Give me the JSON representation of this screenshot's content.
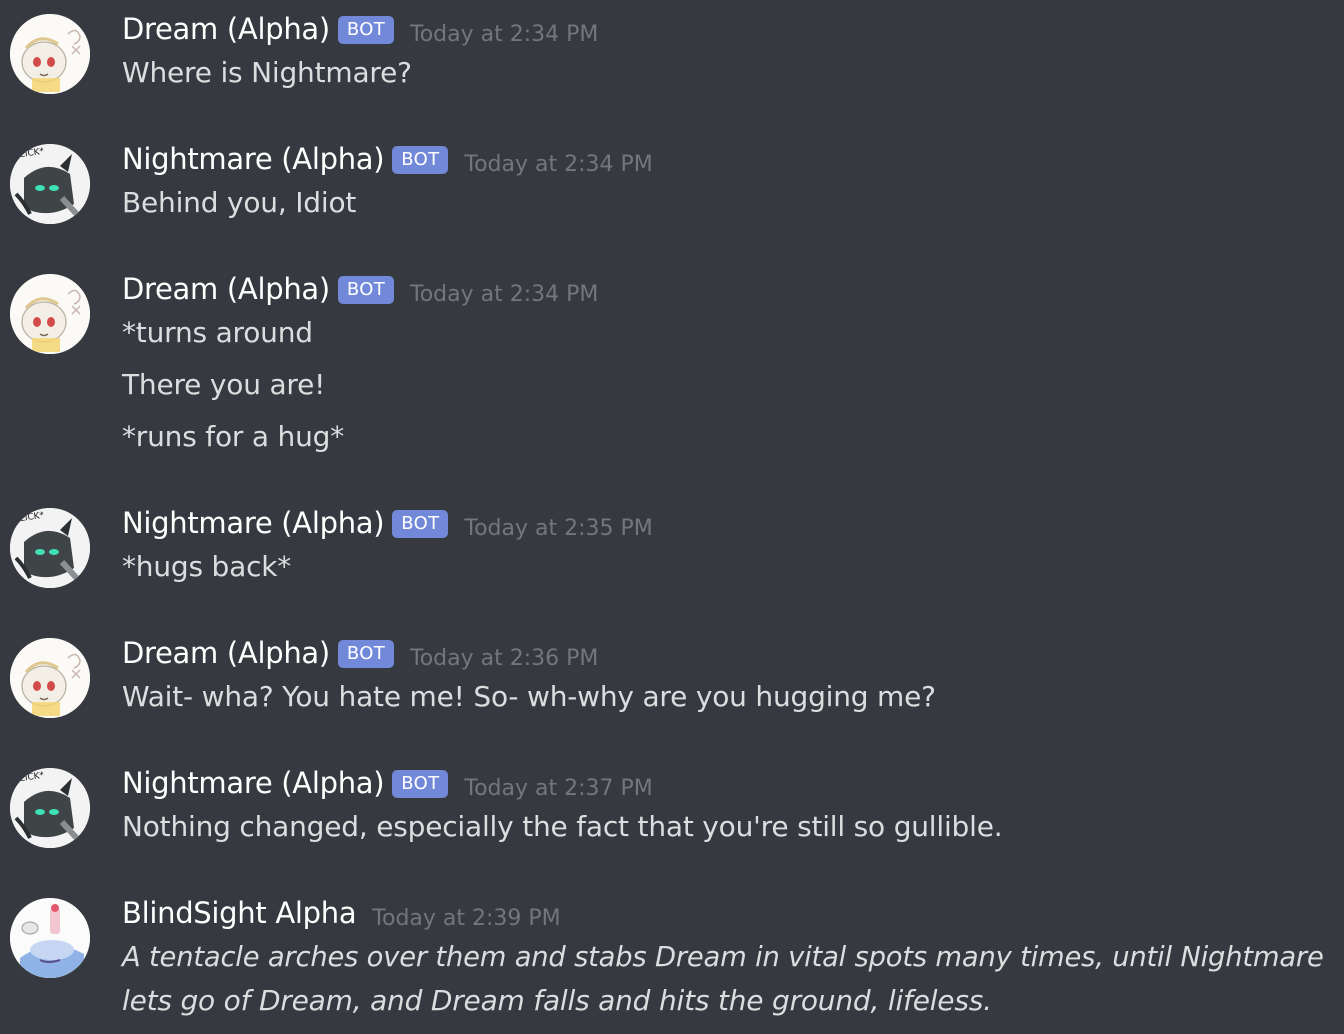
{
  "badge_label": "BOT",
  "colors": {
    "background": "#36393f",
    "username": "#ffffff",
    "message_text": "#dcddde",
    "timestamp": "#72767d",
    "bot_badge": "#7289da"
  },
  "messages": [
    {
      "author": "Dream (Alpha)",
      "avatar": "dream-avatar",
      "is_bot": true,
      "timestamp": "Today at 2:34 PM",
      "lines": [
        "Where is Nightmare?"
      ]
    },
    {
      "author": "Nightmare (Alpha)",
      "avatar": "nightmare-avatar",
      "is_bot": true,
      "timestamp": "Today at 2:34 PM",
      "lines": [
        "Behind you, Idiot"
      ]
    },
    {
      "author": "Dream (Alpha)",
      "avatar": "dream-avatar",
      "is_bot": true,
      "timestamp": "Today at 2:34 PM",
      "lines": [
        "*turns around",
        "There you are!",
        "*runs for a hug*"
      ]
    },
    {
      "author": "Nightmare (Alpha)",
      "avatar": "nightmare-avatar",
      "is_bot": true,
      "timestamp": "Today at 2:35 PM",
      "lines": [
        "*hugs back*"
      ]
    },
    {
      "author": "Dream (Alpha)",
      "avatar": "dream-avatar",
      "is_bot": true,
      "timestamp": "Today at 2:36 PM",
      "lines": [
        "Wait- wha? You hate me! So- wh-why are you hugging me?"
      ]
    },
    {
      "author": "Nightmare (Alpha)",
      "avatar": "nightmare-avatar",
      "is_bot": true,
      "timestamp": "Today at 2:37 PM",
      "lines": [
        "Nothing changed, especially the fact that you're still so gullible."
      ]
    },
    {
      "author": "BlindSight Alpha",
      "avatar": "blindsight-avatar",
      "is_bot": false,
      "timestamp": "Today at 2:39 PM",
      "lines": [
        "A tentacle arches over them and stabs Dream in vital spots many times, until Nightmare",
        "lets go of Dream, and Dream falls and hits the ground, lifeless."
      ],
      "italic": true
    }
  ]
}
